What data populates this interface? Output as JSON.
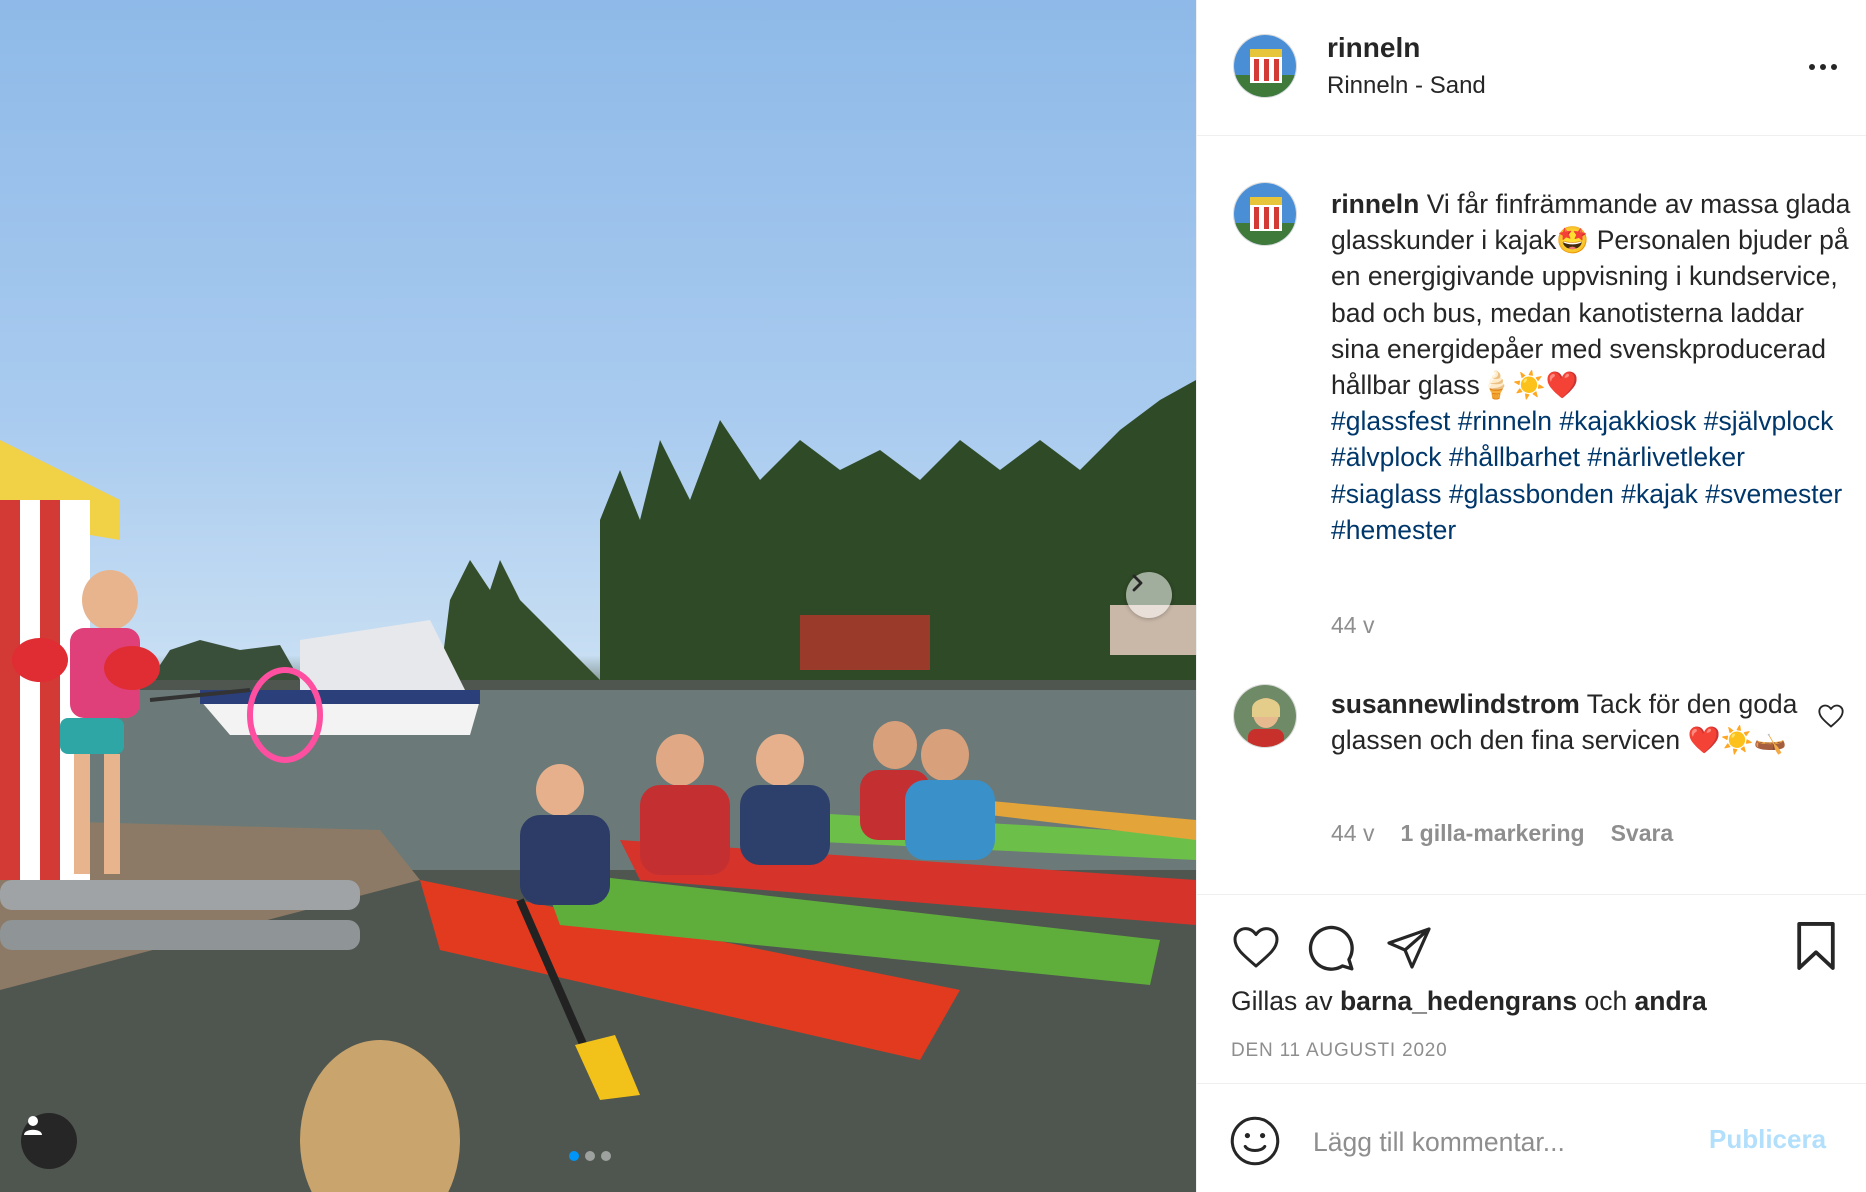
{
  "post": {
    "account": "rinneln",
    "location": "Rinneln - Sand",
    "caption": {
      "author": "rinneln",
      "text": " Vi får finfrämmande av massa glada glasskunder i kajak🤩 Personalen bjuder på en energigivande uppvisning i kundservice, bad och bus, medan kanotisterna laddar sina energidepåer med svenskproducerad hållbar glass🍦☀️❤️",
      "hashtags": [
        "#glassfest",
        "#rinneln",
        "#kajakkiosk",
        "#självplock",
        "#älvplock",
        "#hållbarhet",
        "#närlivetleker",
        "#siaglass",
        "#glassbonden",
        "#kajak",
        "#svemester",
        "#hemester"
      ],
      "age": "44 v"
    },
    "comments": [
      {
        "author": "susannewlindstrom",
        "text": " Tack för den goda glassen och den fina servicen ❤️☀️🛶",
        "age": "44 v",
        "likes": "1 gilla-markering",
        "reply": "Svara"
      }
    ],
    "liked_by": {
      "prefix": "Gillas av ",
      "name": "barna_hedengrans",
      "middle": " och ",
      "others": "andra"
    },
    "date": "DEN 11 AUGUSTI 2020",
    "comment_placeholder": "Lägg till kommentar...",
    "publish_label": "Publicera"
  },
  "carousel": {
    "current_slide": 1,
    "total_slides": 3
  },
  "icons": {
    "more": "more-horizontal-icon",
    "heart": "heart-icon",
    "comment": "comment-icon",
    "share": "share-icon",
    "save": "bookmark-icon",
    "emoji": "emoji-icon",
    "next": "chevron-right-icon",
    "user_tag": "user-icon"
  },
  "colors": {
    "hashtag": "#00376b",
    "muted": "#8e8e8e",
    "publish_disabled": "#b2dffc",
    "carousel_active": "#0095f6"
  }
}
